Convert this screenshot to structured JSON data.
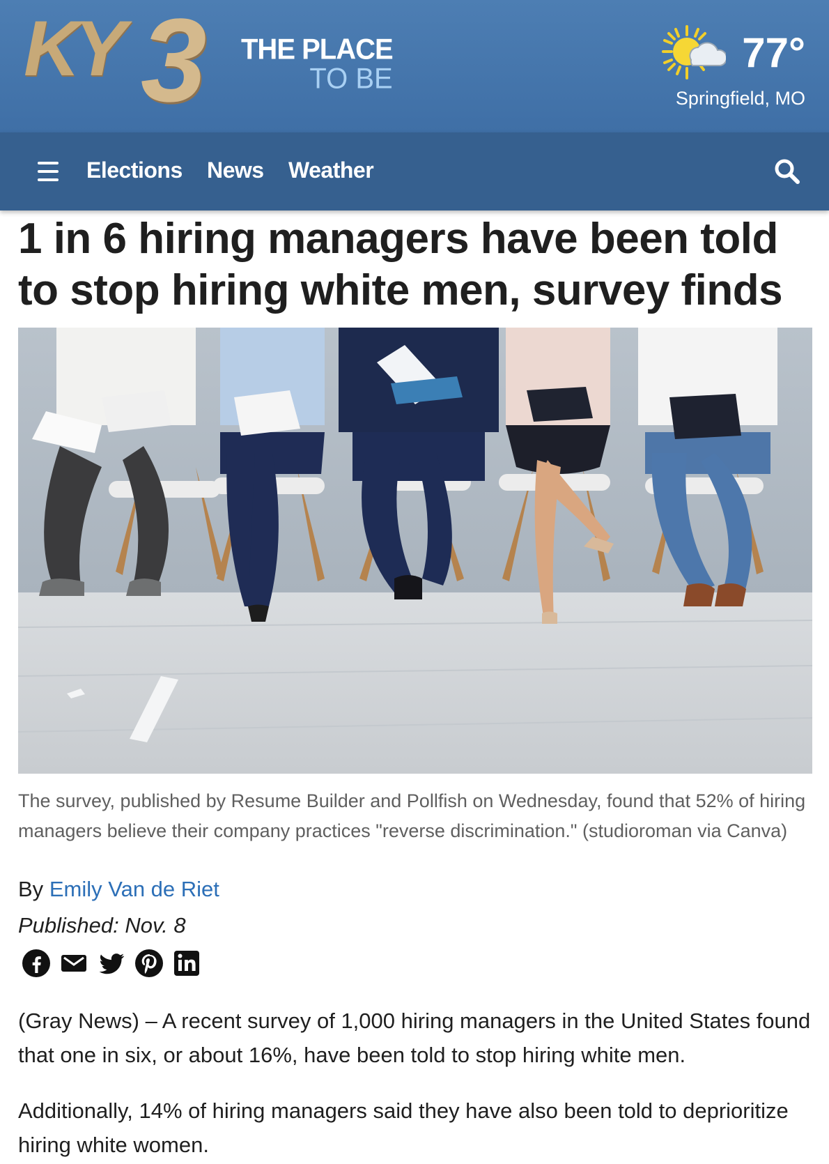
{
  "brand": {
    "logo_text": "KY3",
    "tagline_line1": "THE PLACE",
    "tagline_line2": "TO BE",
    "primary_color": "#4d7eb3",
    "nav_color": "#36608f",
    "logo_color": "#c7a978"
  },
  "weather": {
    "icon": "partly-sunny-icon",
    "temperature": "77°",
    "location": "Springfield, MO"
  },
  "nav": {
    "menu_icon": "hamburger-menu-icon",
    "items": [
      {
        "label": "Elections"
      },
      {
        "label": "News"
      },
      {
        "label": "Weather"
      }
    ],
    "search_icon": "search-icon"
  },
  "article": {
    "headline": "1 in 6 hiring managers have been told to stop hiring white men, survey finds",
    "image_caption": "The survey, published by Resume Builder and Pollfish on Wednesday, found that 52% of hiring managers believe their company practices \"reverse discrimination.\"  (studioroman via Canva)",
    "byline_prefix": "By",
    "author": "Emily Van de Riet",
    "published": "Published: Nov. 8",
    "link_color": "#2c6fb7",
    "share_icons": [
      "facebook-icon",
      "email-icon",
      "twitter-icon",
      "pinterest-icon",
      "linkedin-icon"
    ],
    "paragraphs": [
      "(Gray News) – A recent survey of 1,000 hiring managers in the United States found that one in six, or about 16%, have been told to stop hiring white men.",
      "Additionally, 14% of hiring managers said they have also been told to deprioritize hiring white women."
    ]
  }
}
